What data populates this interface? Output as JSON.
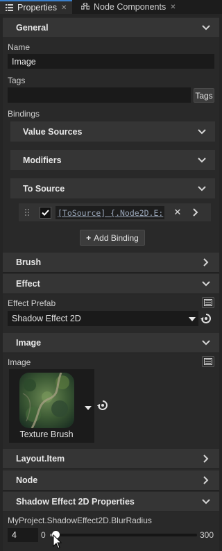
{
  "tabs": [
    {
      "label": "Properties",
      "icon": "list-icon",
      "active": true
    },
    {
      "label": "Node Components",
      "icon": "components-icon",
      "active": false
    }
  ],
  "general": {
    "title": "General",
    "name_label": "Name",
    "name_value": "Image",
    "tags_label": "Tags",
    "tags_value": "",
    "tags_button": "Tags",
    "bindings_label": "Bindings",
    "value_sources": "Value Sources",
    "modifiers": "Modifiers",
    "to_source": "To Source",
    "binding_expression": "[ToSource] {.Node2D.E:",
    "add_binding": "Add Binding"
  },
  "brush": {
    "title": "Brush"
  },
  "effect": {
    "title": "Effect",
    "prefab_label": "Effect Prefab",
    "prefab_value": "Shadow Effect 2D"
  },
  "image": {
    "title": "Image",
    "image_label": "Image",
    "thumbnail_caption": "Texture Brush"
  },
  "layout_item": {
    "title": "Layout.Item"
  },
  "node": {
    "title": "Node"
  },
  "shadow": {
    "title": "Shadow Effect 2D Properties",
    "property_label": "MyProject.ShadowEffect2D.BlurRadius",
    "value": "4",
    "slider_min": "0",
    "slider_max": "300",
    "slider_fraction": 0.013
  },
  "colors": {
    "accent": "#3a7fcb",
    "panel": "#292929",
    "header": "#353535",
    "field": "#1a1a1a"
  }
}
